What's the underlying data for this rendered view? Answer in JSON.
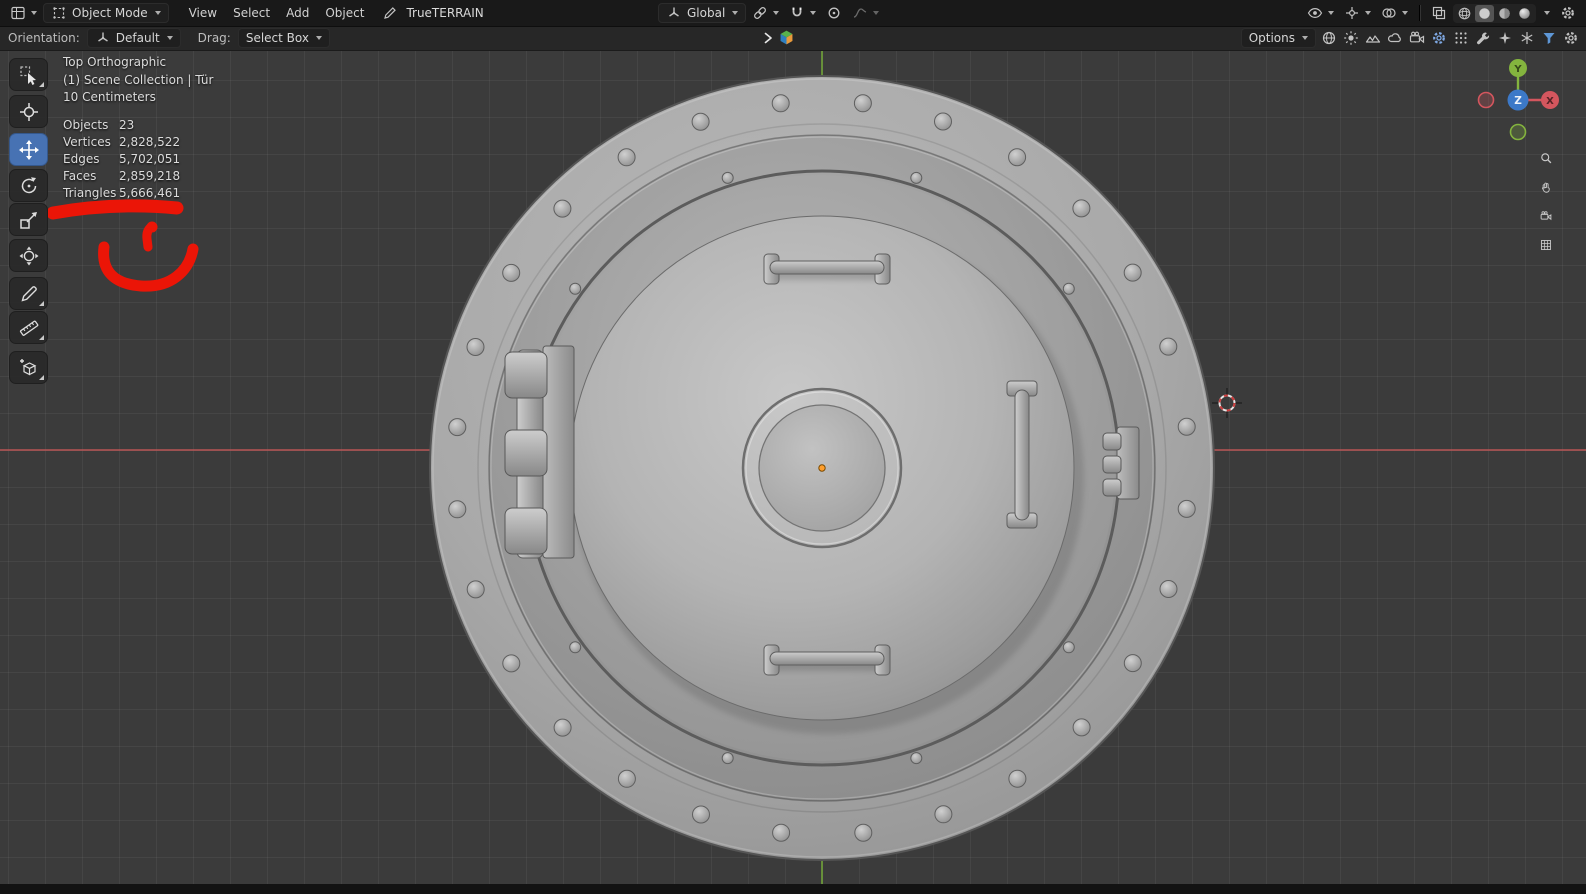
{
  "header": {
    "mode_label": "Object Mode",
    "menus": [
      {
        "label": "View"
      },
      {
        "label": "Select"
      },
      {
        "label": "Add"
      },
      {
        "label": "Object"
      }
    ],
    "addon_label": "TrueTERRAIN",
    "orientation_label": "Global"
  },
  "tool_settings": {
    "orientation_label": "Orientation:",
    "orientation_value": "Default",
    "drag_label": "Drag:",
    "drag_value": "Select Box",
    "options_label": "Options"
  },
  "viewport": {
    "view_label": "Top Orthographic",
    "context_label": "(1) Scene Collection | Tür",
    "unit_label": "10 Centimeters",
    "stats": {
      "rows": [
        {
          "label": "Objects",
          "value": "23"
        },
        {
          "label": "Vertices",
          "value": "2,828,522"
        },
        {
          "label": "Edges",
          "value": "5,702,051"
        },
        {
          "label": "Faces",
          "value": "2,859,218"
        },
        {
          "label": "Triangles",
          "value": "5,666,461"
        }
      ]
    },
    "axis_gizmo": {
      "x_label": "X",
      "y_label": "Y",
      "z_label": "Z"
    }
  },
  "colors": {
    "accent_blue": "#4772b3",
    "annotation_red": "#eb1507",
    "axis_x_red": "#b95555",
    "axis_y_green": "#6e9e3a",
    "door_gray": "#a9a9a9"
  }
}
